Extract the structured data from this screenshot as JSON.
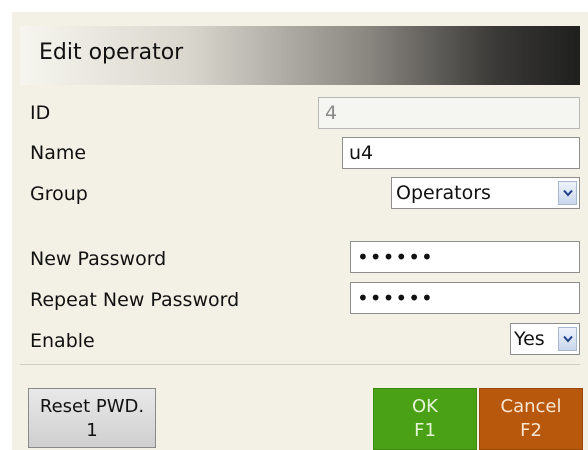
{
  "dialog": {
    "title": "Edit operator"
  },
  "fields": {
    "id_label": "ID",
    "id_value": "4",
    "name_label": "Name",
    "name_value": "u4",
    "group_label": "Group",
    "group_value": "Operators",
    "new_password_label": "New Password",
    "new_password_value": "••••••",
    "repeat_password_label": "Repeat New Password",
    "repeat_password_value": "••••••",
    "enable_label": "Enable",
    "enable_value": "Yes"
  },
  "buttons": {
    "reset_line1": "Reset PWD.",
    "reset_line2": "1",
    "ok_line1": "OK",
    "ok_line2": "F1",
    "cancel_line1": "Cancel",
    "cancel_line2": "F2"
  },
  "colors": {
    "ok": "#4aa115",
    "cancel": "#b8580d",
    "panel": "#f3f1e6"
  },
  "icons": {
    "dropdown": "chevron-down-icon"
  }
}
